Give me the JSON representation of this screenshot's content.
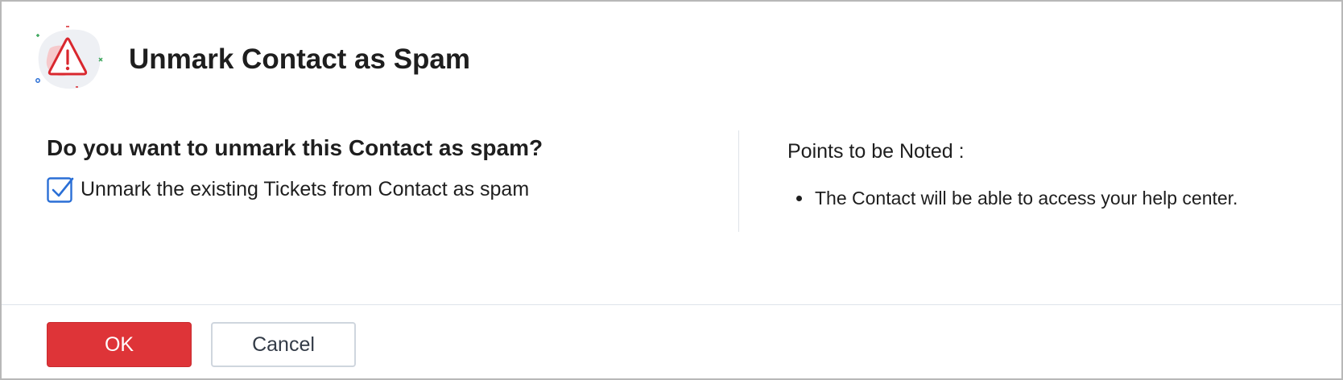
{
  "dialog": {
    "title": "Unmark Contact as Spam",
    "icon": "warning-triangle-icon"
  },
  "main": {
    "question": "Do you want to unmark this Contact as spam?",
    "checkbox": {
      "label": "Unmark the existing Tickets from Contact as spam",
      "checked": true
    }
  },
  "notes": {
    "title": "Points to be Noted :",
    "items": [
      "The Contact will be able to access your help center."
    ]
  },
  "footer": {
    "ok_label": "OK",
    "cancel_label": "Cancel"
  },
  "colors": {
    "primary_button": "#de3438",
    "checkbox_accent": "#2a6fd6",
    "warning_icon": "#d9272e"
  }
}
